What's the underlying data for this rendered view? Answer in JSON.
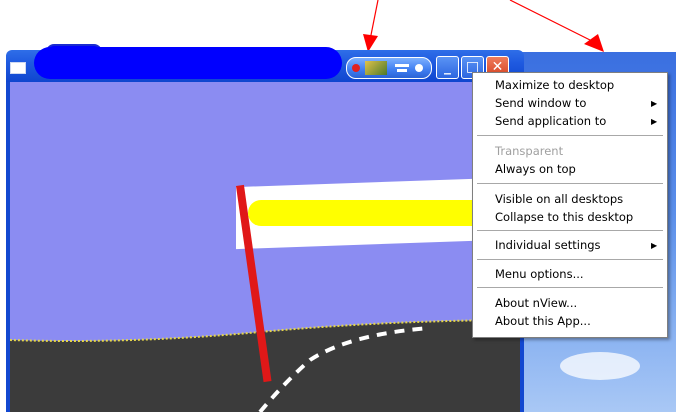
{
  "window": {
    "title": "",
    "nview_buttons": [
      "nview-stop-icon",
      "nview-thumbnail-icon",
      "nview-list-icon",
      "nview-dot-icon"
    ],
    "controls": {
      "minimize": "_",
      "maximize": "□",
      "close": "✕"
    }
  },
  "menu": {
    "items": [
      {
        "label": "Maximize to desktop",
        "enabled": true,
        "submenu": false
      },
      {
        "label": "Send window to",
        "enabled": true,
        "submenu": true
      },
      {
        "label": "Send application to",
        "enabled": true,
        "submenu": true
      },
      {
        "label": "Transparent",
        "enabled": false,
        "submenu": false
      },
      {
        "label": "Always on top",
        "enabled": true,
        "submenu": false
      },
      {
        "label": "Visible on all desktops",
        "enabled": true,
        "submenu": false
      },
      {
        "label": "Collapse to this desktop",
        "enabled": true,
        "submenu": false
      },
      {
        "label": "Individual settings",
        "enabled": true,
        "submenu": true
      },
      {
        "label": "Menu options...",
        "enabled": true,
        "submenu": false
      },
      {
        "label": "About nView...",
        "enabled": true,
        "submenu": false
      },
      {
        "label": "About this App...",
        "enabled": true,
        "submenu": false
      }
    ],
    "submenu_arrow": "▶"
  },
  "colors": {
    "titlebar": "#1f5ae0",
    "redaction_title": "#0000ff",
    "redaction_banner": "#ffff00",
    "scene_sky": "#8b8cf2",
    "road": "#3a3a3a",
    "arrow": "#ff0000"
  }
}
